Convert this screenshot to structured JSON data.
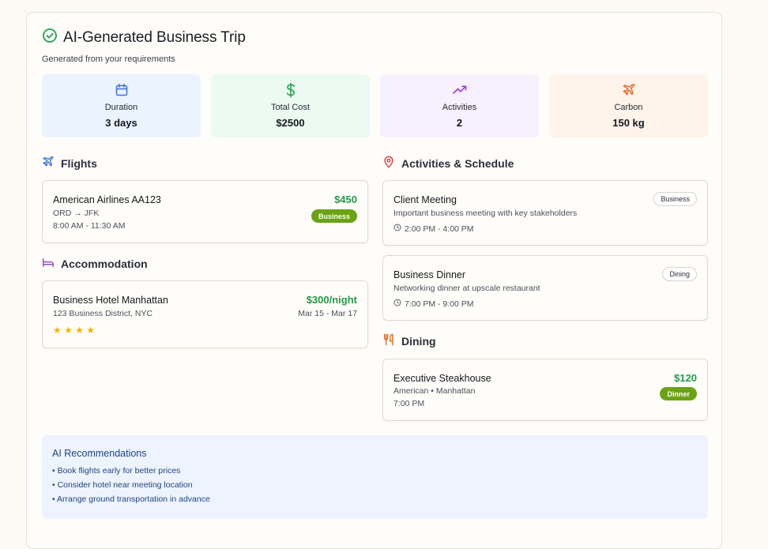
{
  "header": {
    "title": "AI-Generated Business Trip",
    "subtitle": "Generated from your requirements"
  },
  "stats": [
    {
      "label": "Duration",
      "value": "3 days",
      "icon": "calendar-icon",
      "bg": "#ebf3ff",
      "color": "#3b6fd8"
    },
    {
      "label": "Total Cost",
      "value": "$2500",
      "icon": "dollar-icon",
      "bg": "#ebfbf2",
      "color": "#22a04a"
    },
    {
      "label": "Activities",
      "value": "2",
      "icon": "trending-up-icon",
      "bg": "#f7f0ff",
      "color": "#9a3fd6"
    },
    {
      "label": "Carbon",
      "value": "150 kg",
      "icon": "plane-icon",
      "bg": "#fff3ea",
      "color": "#e2641c"
    }
  ],
  "flights": {
    "title": "Flights",
    "item": {
      "name": "American Airlines AA123",
      "route": "ORD → JFK",
      "time": "8:00 AM - 11:30 AM",
      "price": "$450",
      "badge": "Business"
    }
  },
  "accommodation": {
    "title": "Accommodation",
    "item": {
      "name": "Business Hotel Manhattan",
      "address": "123 Business District, NYC",
      "price": "$300/night",
      "dates": "Mar 15 - Mar 17",
      "rating": 4,
      "stars": "★ ★ ★ ★"
    }
  },
  "activities": {
    "title": "Activities & Schedule",
    "items": [
      {
        "name": "Client Meeting",
        "desc": "Important business meeting with key stakeholders",
        "time": "2:00 PM - 4:00 PM",
        "tag": "Business"
      },
      {
        "name": "Business Dinner",
        "desc": "Networking dinner at upscale restaurant",
        "time": "7:00 PM - 9:00 PM",
        "tag": "Dining"
      }
    ]
  },
  "dining": {
    "title": "Dining",
    "item": {
      "name": "Executive Steakhouse",
      "detail": "American • Manhattan",
      "time": "7:00 PM",
      "price": "$120",
      "badge": "Dinner"
    }
  },
  "recommendations": {
    "title": "AI Recommendations",
    "items": [
      "• Book flights early for better prices",
      "• Consider hotel near meeting location",
      "• Arrange ground transportation in advance"
    ]
  },
  "colors": {
    "price_green": "#239a48",
    "badge_green": "#6aa313",
    "accent_blue": "#3b6fd8",
    "accent_purple": "#8a3fd6",
    "pin_red": "#d8343a",
    "fork_orange": "#e2641c"
  }
}
